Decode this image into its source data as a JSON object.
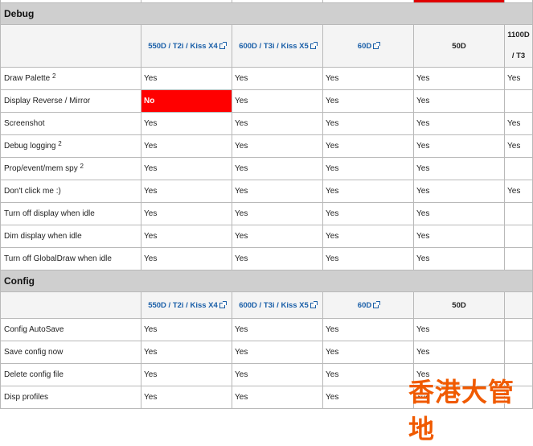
{
  "columns": {
    "c1": "550D / T2i / Kiss X4",
    "c2": "600D / T3i / Kiss X5",
    "c3": "60D",
    "c4": "50D",
    "c5": "1100D / T3"
  },
  "debug": {
    "title": "Debug",
    "rows": [
      {
        "feature": "Draw Palette",
        "note": "2",
        "v": [
          "Yes",
          "Yes",
          "Yes",
          "Yes",
          "Yes"
        ]
      },
      {
        "feature": "Display Reverse / Mirror",
        "note": "",
        "v": [
          "No",
          "Yes",
          "Yes",
          "Yes",
          ""
        ]
      },
      {
        "feature": "Screenshot",
        "note": "",
        "v": [
          "Yes",
          "Yes",
          "Yes",
          "Yes",
          "Yes"
        ]
      },
      {
        "feature": "Debug logging",
        "note": "2",
        "v": [
          "Yes",
          "Yes",
          "Yes",
          "Yes",
          "Yes"
        ]
      },
      {
        "feature": "Prop/event/mem spy",
        "note": "2",
        "v": [
          "Yes",
          "Yes",
          "Yes",
          "Yes",
          ""
        ]
      },
      {
        "feature": "Don't click me :)",
        "note": "",
        "v": [
          "Yes",
          "Yes",
          "Yes",
          "Yes",
          "Yes"
        ]
      },
      {
        "feature": "Turn off display when idle",
        "note": "",
        "v": [
          "Yes",
          "Yes",
          "Yes",
          "Yes",
          ""
        ]
      },
      {
        "feature": "Dim display when idle",
        "note": "",
        "v": [
          "Yes",
          "Yes",
          "Yes",
          "Yes",
          ""
        ]
      },
      {
        "feature": "Turn off GlobalDraw when idle",
        "note": "",
        "v": [
          "Yes",
          "Yes",
          "Yes",
          "Yes",
          ""
        ]
      }
    ]
  },
  "config": {
    "title": "Config",
    "rows": [
      {
        "feature": "Config AutoSave",
        "note": "",
        "v": [
          "Yes",
          "Yes",
          "Yes",
          "Yes",
          ""
        ]
      },
      {
        "feature": "Save config now",
        "note": "",
        "v": [
          "Yes",
          "Yes",
          "Yes",
          "Yes",
          ""
        ]
      },
      {
        "feature": "Delete config file",
        "note": "",
        "v": [
          "Yes",
          "Yes",
          "Yes",
          "Yes",
          ""
        ]
      },
      {
        "feature": "Disp profiles",
        "note": "",
        "v": [
          "Yes",
          "Yes",
          "Yes",
          "Yes",
          ""
        ]
      }
    ]
  },
  "watermark": "香港大管地",
  "colors": {
    "no_cell": "#ff0000",
    "link": "#1a5fa8",
    "section_bg": "#cfcfcf"
  }
}
